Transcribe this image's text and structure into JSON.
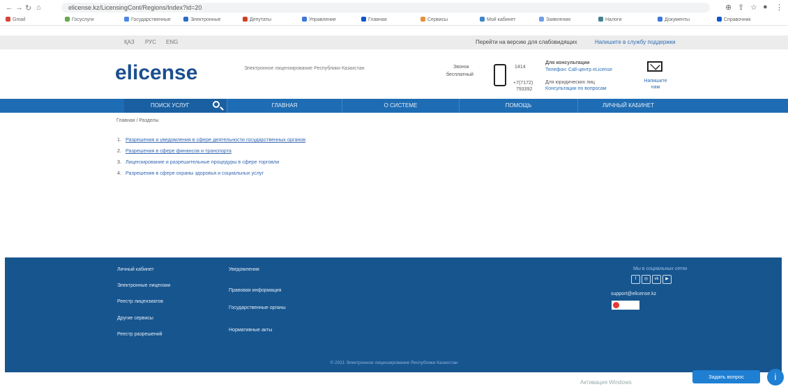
{
  "browser": {
    "url": "elicense.kz/LicensingCont/Regions/Index?id=20"
  },
  "bookmarks": [
    {
      "label": "Gmail",
      "color": "#d44638"
    },
    {
      "label": "Госуслуги",
      "color": "#6aa84f"
    },
    {
      "label": "Государственные",
      "color": "#4a86e8"
    },
    {
      "label": "Электронные",
      "color": "#2d6bc6"
    },
    {
      "label": "Депутаты",
      "color": "#cc4125"
    },
    {
      "label": "Управление",
      "color": "#3c78d8"
    },
    {
      "label": "Главная",
      "color": "#1155cc"
    },
    {
      "label": "Сервисы",
      "color": "#e69138"
    },
    {
      "label": "Мой кабинет",
      "color": "#3d85c6"
    },
    {
      "label": "Заявления",
      "color": "#6d9eeb"
    },
    {
      "label": "Налоги",
      "color": "#45818e"
    },
    {
      "label": "Документы",
      "color": "#3c78d8"
    },
    {
      "label": "Справочник",
      "color": "#1155cc"
    }
  ],
  "topbar": {
    "languages": [
      "ҚАЗ",
      "РУС",
      "ENG"
    ],
    "version_link": "Перейти на версию для слабовидящих",
    "support_link": "Напишите в службу поддержки"
  },
  "header": {
    "logo": "elicense",
    "subtitle": "Электронное лицензирование Республики Казахстан",
    "call_label": "Звонок",
    "call_sub": "бесплатный",
    "phone_a": "1414",
    "phone_b": "+7(7172)",
    "phone_b_sub": "793392",
    "contact_title": "Для консультации",
    "contact_a": "Телефон: Call-центр eLicense",
    "contact_b": "Для юридических лиц",
    "contact_c": "Консультации по вопросам",
    "mail_label": "Напишите нам"
  },
  "nav": {
    "search_label": "ПОИСК УСЛУГ",
    "items": [
      "ГЛАВНАЯ",
      "О СИСТЕМЕ",
      "ПОМОЩЬ",
      "ЛИЧНЫЙ КАБИНЕТ"
    ]
  },
  "breadcrumbs": "Главная / Разделы",
  "content": {
    "items": [
      {
        "num": "1.",
        "text": "Разрешения и уведомления в сфере деятельности государственных органов"
      },
      {
        "num": "2.",
        "text": "Разрешения в сфере финансов и транспорта"
      },
      {
        "num": "3.",
        "text": "Лицензирование и разрешительные процедуры в сфере торговли"
      },
      {
        "num": "4.",
        "text": "Разрешения в сфере охраны здоровья и социальных услуг"
      }
    ]
  },
  "footer": {
    "col1": [
      "Личный кабинет",
      "Электронные лицензии",
      "Реестр лицензиатов",
      "Другие сервисы",
      "Реестр разрешений"
    ],
    "col2": [
      "Уведомления",
      "Правовая информация",
      "Государственные органы",
      "Нормативные акты"
    ],
    "social_title": "Мы в социальных сетях",
    "support_note": "support@elicense.kz",
    "copyright": "© 2021 Электронное лицензирование Республики Казахстан"
  },
  "overlay": {
    "windows_activation": "Активация Windows",
    "help_button": "Задать вопрос",
    "help_icon": "i"
  }
}
